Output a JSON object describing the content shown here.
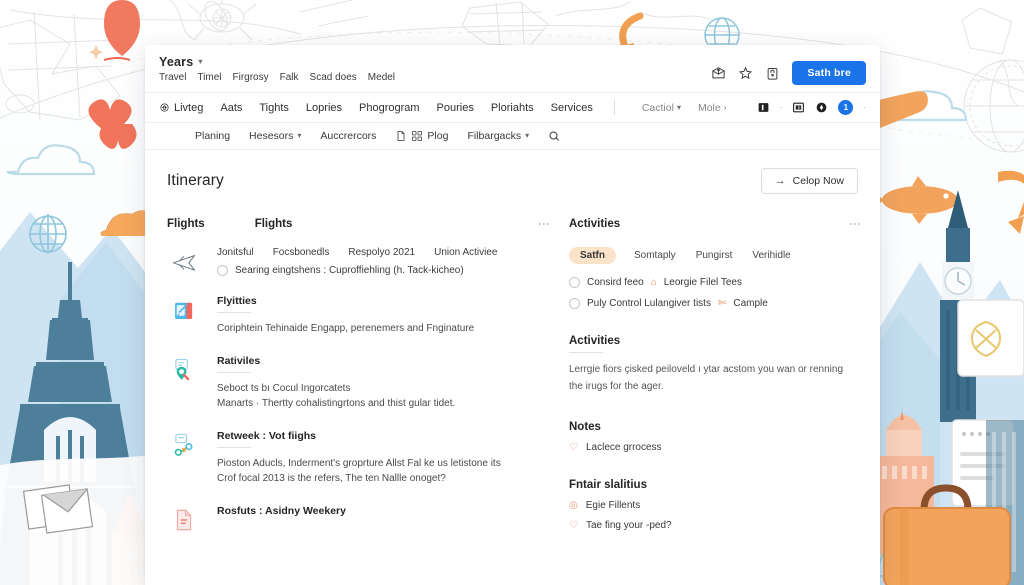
{
  "browser": {
    "profile_name": "Years",
    "profile_chevron": "chevron-down",
    "bookmarks": [
      "Travel",
      "Timel",
      "Firgrosy",
      "Falk",
      "Scad does",
      "Medel"
    ],
    "actions": {
      "share_icon": "share-box-icon",
      "star_icon": "star-icon",
      "lock_icon": "lock-icon",
      "signin_label": "Sath bre"
    }
  },
  "appnav": {
    "items": [
      {
        "label": "Livteg",
        "icon": "home-icon"
      },
      {
        "label": "Aats",
        "icon": ""
      },
      {
        "label": "Tights",
        "icon": ""
      },
      {
        "label": "Lopries",
        "icon": ""
      },
      {
        "label": "Phogrogram",
        "icon": ""
      },
      {
        "label": "Pouries",
        "icon": ""
      },
      {
        "label": "Ploriahts",
        "icon": ""
      },
      {
        "label": "Services",
        "icon": ""
      }
    ],
    "muted": [
      {
        "label": "Cactiol",
        "chevron": "chevron-down"
      },
      {
        "label": "Mole",
        "chevron": "chevron-right"
      }
    ],
    "right_icons": [
      "panel-icon",
      "library-icon",
      "circle-icon"
    ],
    "badge_count": "1"
  },
  "toolbar": {
    "items": [
      {
        "label": "Planing",
        "icon": "",
        "chevron": ""
      },
      {
        "label": "Hesesors",
        "icon": "",
        "chevron": "chevron-down"
      },
      {
        "label": "Auccrercors",
        "icon": "",
        "chevron": ""
      },
      {
        "label": "Plog",
        "icon": "doc-grid-icon",
        "chevron": ""
      },
      {
        "label": "Filbargacks",
        "icon": "",
        "chevron": "chevron-down"
      }
    ],
    "search_icon": "search-icon"
  },
  "page": {
    "title": "Itinerary",
    "cta": {
      "arrow": "→",
      "label": "Celop Now"
    }
  },
  "left_column": {
    "side_label": "Flights",
    "header": "Flights",
    "kebab": "more-options",
    "rows": [
      {
        "icon": "airplane-icon",
        "chips": [
          "Jonitsful",
          "Focsbonedls",
          "Respolyo 2021",
          "Union Activiee"
        ],
        "radio_text": "Searing eingtshens : Cuproffiehling (h. Tack-kicheo)",
        "title": "",
        "text": ""
      },
      {
        "icon": "notebook-icon",
        "chips": [],
        "radio_text": "",
        "title": "Flyitties",
        "text": "Coriphtein Tehinaide Engapp, perenemers and Fnginature"
      },
      {
        "icon": "search-pin-icon",
        "chips": [],
        "radio_text": "",
        "title": "Rativiles",
        "text": "Seboct ts bı Cocul Ingorcatets\nManarts · Thertty cohalistingrtons and thist gular tidet."
      },
      {
        "icon": "link-nodes-icon",
        "chips": [],
        "radio_text": "",
        "title": "Retweek  :  Vot fiighs",
        "text": "Pioston Aducls, Inderment's groprture Allst Fal ke us letistone its\nCrof focal 2013 is the refers, The ten Nallle onoget?"
      },
      {
        "icon": "document-icon",
        "chips": [],
        "radio_text": "",
        "title": "Rosfuts  :  Asidny Weekery",
        "text": ""
      }
    ]
  },
  "right_column": {
    "header": "Activities",
    "kebab": "more-options",
    "tabs": [
      {
        "label": "Satfn",
        "active": true
      },
      {
        "label": "Somtaply",
        "active": false
      },
      {
        "label": "Pungirst",
        "active": false
      },
      {
        "label": "Verihidle",
        "active": false
      }
    ],
    "options": [
      {
        "text": "Consird feeo",
        "icon_label": "Leorgie Filel Tees",
        "icon": "tag-icon"
      },
      {
        "text": "Puly Control Lulangiver tists",
        "icon_label": "Cample",
        "icon": "scissors-icon"
      }
    ],
    "sections": [
      {
        "title": "Activities",
        "body": "Lerrgie fiors çisked peiloveld ı ytar acstom you wan or renning the irugs for the ager.",
        "notes": []
      },
      {
        "title": "Notes",
        "body": "",
        "notes": [
          {
            "icon": "heart-icon",
            "text": "Laclece grrocess"
          }
        ]
      },
      {
        "title": "Fntair slalitius",
        "body": "",
        "notes": [
          {
            "icon": "target-icon",
            "text": "Egie Fillents"
          },
          {
            "icon": "heart-icon",
            "text": "Tae fing your -ped?"
          }
        ]
      }
    ]
  },
  "colors": {
    "accent_blue": "#1a73e8",
    "chip_peach": "#fae3c8",
    "icon_orange": "#e8865a",
    "bg_cream": "#fdfcfa"
  }
}
